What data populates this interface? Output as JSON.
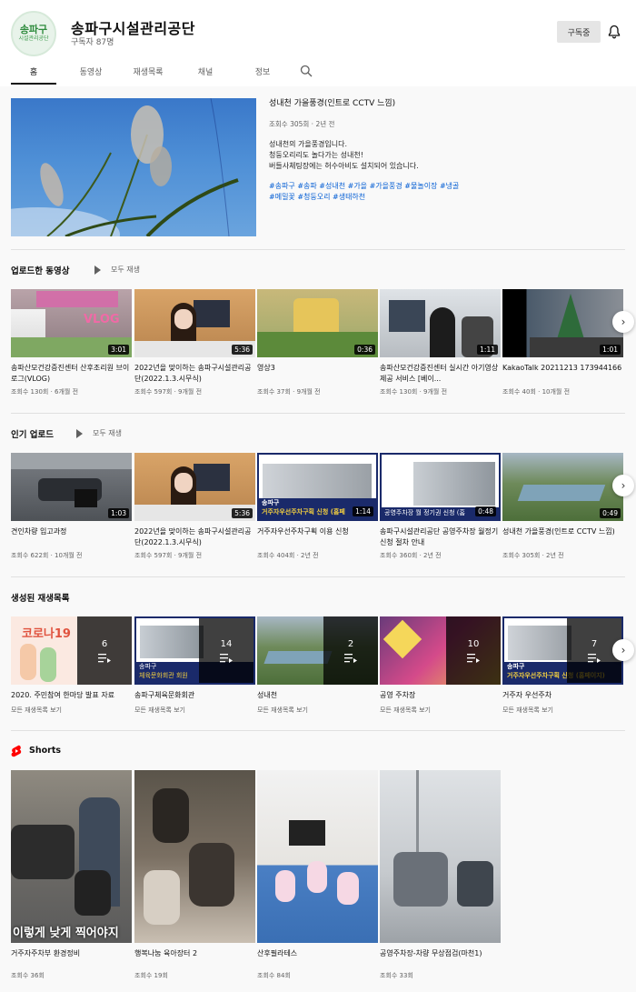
{
  "channel": {
    "logo_line1": "송파구",
    "logo_line2": "시설관리공단",
    "name": "송파구시설관리공단",
    "subscribers": "구독자 87명",
    "subscribe_label": "구독중"
  },
  "tabs": [
    {
      "label": "홈"
    },
    {
      "label": "동영상"
    },
    {
      "label": "재생목록"
    },
    {
      "label": "채널"
    },
    {
      "label": "정보"
    }
  ],
  "featured": {
    "title": "성내천 가을풍경(인트로 CCTV 느낌)",
    "meta": "조회수 305회 · 2년 전",
    "desc": [
      "성내천의 가을풍경입니다.",
      "청둥오리리도 놀다가는 성내천!",
      "버들사체팅장에는 허수아비도 설치되어 있습니다."
    ],
    "tags": [
      "#송파구 #송파 #성내천 #가을 #가을풍경 #물놀이장 #냉골",
      "#메밀꽃 #청둥오리 #생태하천"
    ]
  },
  "sections": {
    "uploads": {
      "title": "업로드한 동영상",
      "playall": "모두 재생"
    },
    "popular": {
      "title": "인기 업로드",
      "playall": "모두 재생"
    },
    "playlists": {
      "title": "생성된 재생목록"
    },
    "shorts": {
      "title": "Shorts"
    }
  },
  "uploads": [
    {
      "title": "송파산모건강증진센터 산후조리원 브이로그(VLOG)",
      "meta": "조회수 130회 · 6개월 전",
      "duration": "3:01",
      "overlay": "VLOG"
    },
    {
      "title": "2022년을 맞이하는 송파구시설관리공단(2022.1.3.시무식)",
      "meta": "조회수 597회 · 9개월 전",
      "duration": "5:36"
    },
    {
      "title": "영상3",
      "meta": "조회수 37회 · 9개월 전",
      "duration": "0:36"
    },
    {
      "title": "송파산모건강증진센터 실시간 아기영상 제공 서비스 [베이...",
      "meta": "조회수 130회 · 9개월 전",
      "duration": "1:11"
    },
    {
      "title": "KakaoTalk 20211213 173944166",
      "meta": "조회수 40회 · 10개월 전",
      "duration": "1:01"
    }
  ],
  "popular": [
    {
      "title": "견인차량 입고과정",
      "meta": "조회수 622회 · 10개월 전",
      "duration": "1:03"
    },
    {
      "title": "2022년을 맞이하는 송파구시설관리공단(2022.1.3.시무식)",
      "meta": "조회수 597회 · 9개월 전",
      "duration": "5:36"
    },
    {
      "title": "거주자우선주차구획 이용 신청",
      "meta": "조회수 404회 · 2년 전",
      "duration": "1:14",
      "overlay1": "송파구",
      "overlay2": "거주자우선주차구획 신청 (홈페"
    },
    {
      "title": "송파구시설관리공단 공영주차장 월정기 신청 절차 안내",
      "meta": "조회수 360회 · 2년 전",
      "duration": "0:48",
      "overlay2": "공영주차장 월 정기권 신청 (홈"
    },
    {
      "title": "성내천 가을풍경(인트로 CCTV 느낌)",
      "meta": "조회수 305회 · 2년 전",
      "duration": "0:49"
    }
  ],
  "playlists": [
    {
      "title": "2020. 주민참여 한마당 발표 자료",
      "meta": "모든 재생목록 보기",
      "count": "6",
      "overlay": "코로나19"
    },
    {
      "title": "송파구체육문화회관",
      "meta": "모든 재생목록 보기",
      "count": "14",
      "overlay1": "송파구",
      "overlay2": "체육문화회관 회원"
    },
    {
      "title": "성내천",
      "meta": "모든 재생목록 보기",
      "count": "2"
    },
    {
      "title": "공영 주차장",
      "meta": "모든 재생목록 보기",
      "count": "10"
    },
    {
      "title": "거주자 우선주차",
      "meta": "모든 재생목록 보기",
      "count": "7",
      "overlay1": "송파구",
      "overlay2": "거주자우선주차구획 신청 (홈페이지)"
    }
  ],
  "shorts": [
    {
      "title": "거주자주차부 환경정비",
      "meta": "조회수 36회",
      "caption": "이렇게 낮게 찍어야지"
    },
    {
      "title": "행복나눔 육아장터 2",
      "meta": "조회수 19회"
    },
    {
      "title": "산후필라테스",
      "meta": "조회수 84회"
    },
    {
      "title": "공영주차장-차량 무상점검(마천1)",
      "meta": "조회수 33회"
    }
  ]
}
